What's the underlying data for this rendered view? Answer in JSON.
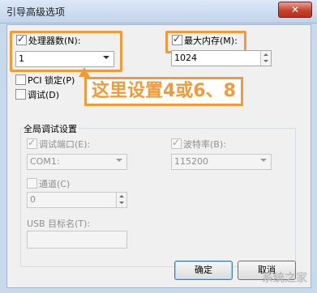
{
  "window": {
    "title": "引导高级选项",
    "close_glyph": "✕"
  },
  "processors": {
    "label": "处理器数(N):",
    "checked": true,
    "value": "1"
  },
  "max_memory": {
    "label": "最大内存(M):",
    "checked": true,
    "value": "1024"
  },
  "pci_lock": {
    "label": "PCI 锁定(P)",
    "checked": false
  },
  "debug": {
    "label": "调试(D)",
    "checked": false
  },
  "callout": {
    "text": "这里设置4或6、8",
    "color": "#f29a3a"
  },
  "global_debug": {
    "title": "全局调试设置",
    "debug_port": {
      "label": "调试端口(E):",
      "checked": true,
      "value": "COM1:"
    },
    "baud_rate": {
      "label": "波特率(B):",
      "checked": true,
      "value": "115200"
    },
    "channel": {
      "label": "通道(C)",
      "checked": false,
      "value": "0"
    },
    "usb_target": {
      "label": "USB 目标名(T):",
      "value": ""
    }
  },
  "buttons": {
    "ok": "确定",
    "cancel": "取消"
  },
  "watermark": "系统之家"
}
